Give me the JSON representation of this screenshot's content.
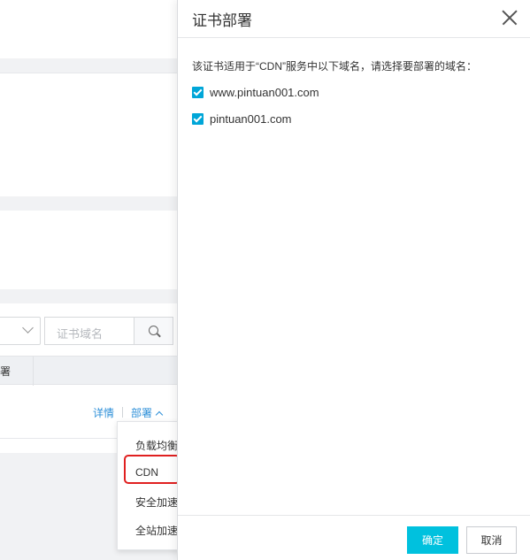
{
  "background": {
    "search": {
      "placeholder": "证书域名"
    },
    "table": {
      "header_partial": "署"
    },
    "row_actions": {
      "detail_link": "详情",
      "deploy_link": "部署"
    },
    "deploy_menu": {
      "items": [
        "负载均衡",
        "CDN",
        "安全加速",
        "全站加速"
      ],
      "highlighted": "CDN"
    }
  },
  "panel": {
    "title": "证书部署",
    "description": "该证书适用于“CDN”服务中以下域名，请选择要部署的域名：",
    "domains": [
      {
        "name": "www.pintuan001.com",
        "checked": true
      },
      {
        "name": "pintuan001.com",
        "checked": true
      }
    ],
    "ok_label": "确定",
    "cancel_label": "取消"
  },
  "colors": {
    "accent": "#00c1de",
    "checkbox": "#00a6d8",
    "link": "#2d8fd8",
    "highlight": "#e02020"
  }
}
